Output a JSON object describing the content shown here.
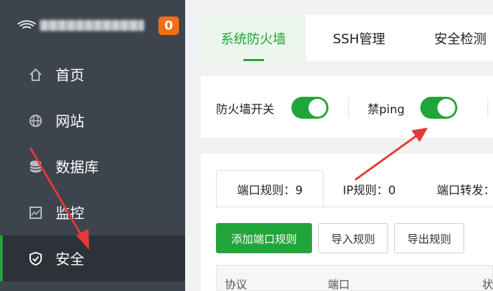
{
  "sidebar": {
    "badge": "0",
    "items": [
      {
        "label": "首页",
        "icon": "home-icon"
      },
      {
        "label": "网站",
        "icon": "globe-icon"
      },
      {
        "label": "数据库",
        "icon": "database-icon"
      },
      {
        "label": "监控",
        "icon": "monitor-icon"
      },
      {
        "label": "安全",
        "icon": "shield-icon",
        "active": true
      }
    ]
  },
  "tabs": [
    {
      "label": "系统防火墙",
      "active": true
    },
    {
      "label": "SSH管理"
    },
    {
      "label": "安全检测"
    }
  ],
  "switches": {
    "firewall_label": "防火墙开关",
    "firewall_on": true,
    "ping_label": "禁ping",
    "ping_on": true
  },
  "rules": {
    "subtabs": [
      "端口规则：9",
      "IP规则：0",
      "端口转发："
    ],
    "buttons": {
      "add": "添加端口规则",
      "import": "导入规则",
      "export": "导出规则"
    },
    "columns": [
      "协议",
      "端口",
      "状"
    ]
  },
  "colors": {
    "accent": "#20a53a",
    "sidebar": "#3c444d",
    "badge": "#f26e16",
    "annotation_arrow": "#e53935"
  }
}
